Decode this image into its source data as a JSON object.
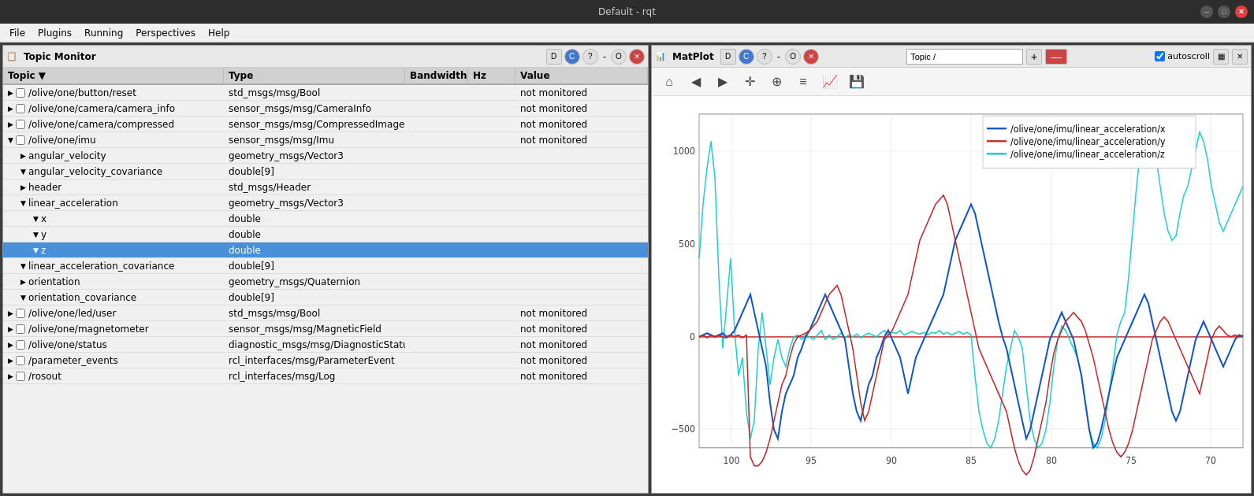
{
  "titlebar": {
    "title": "Default - rqt"
  },
  "menubar": {
    "items": [
      "File",
      "Plugins",
      "Running",
      "Perspectives",
      "Help"
    ]
  },
  "left_panel": {
    "title": "Topic Monitor",
    "table": {
      "headers": [
        "Topic",
        "Type",
        "Bandwidth",
        "Hz",
        "Value"
      ],
      "rows": [
        {
          "indent": 1,
          "expand": true,
          "checked": false,
          "topic": "/olive/one/button/reset",
          "type": "std_msgs/msg/Bool",
          "bandwidth": "",
          "hz": "",
          "value": "not monitored",
          "selected": false
        },
        {
          "indent": 1,
          "expand": true,
          "checked": false,
          "topic": "/olive/one/camera/camera_info",
          "type": "sensor_msgs/msg/CameraInfo",
          "bandwidth": "",
          "hz": "",
          "value": "not monitored",
          "selected": false
        },
        {
          "indent": 1,
          "expand": true,
          "checked": false,
          "topic": "/olive/one/camera/compressed",
          "type": "sensor_msgs/msg/CompressedImage",
          "bandwidth": "",
          "hz": "",
          "value": "not monitored",
          "selected": false
        },
        {
          "indent": 1,
          "expand": false,
          "checked": false,
          "topic": "/olive/one/imu",
          "type": "sensor_msgs/msg/Imu",
          "bandwidth": "",
          "hz": "",
          "value": "not monitored",
          "selected": false
        },
        {
          "indent": 2,
          "expand": true,
          "checked": false,
          "topic": "angular_velocity",
          "type": "geometry_msgs/Vector3",
          "bandwidth": "",
          "hz": "",
          "value": "",
          "selected": false
        },
        {
          "indent": 2,
          "expand": false,
          "checked": false,
          "topic": "angular_velocity_covariance",
          "type": "double[9]",
          "bandwidth": "",
          "hz": "",
          "value": "",
          "selected": false
        },
        {
          "indent": 2,
          "expand": true,
          "checked": false,
          "topic": "header",
          "type": "std_msgs/Header",
          "bandwidth": "",
          "hz": "",
          "value": "",
          "selected": false
        },
        {
          "indent": 2,
          "expand": false,
          "checked": false,
          "topic": "linear_acceleration",
          "type": "geometry_msgs/Vector3",
          "bandwidth": "",
          "hz": "",
          "value": "",
          "selected": false
        },
        {
          "indent": 3,
          "expand": false,
          "checked": false,
          "topic": "x",
          "type": "double",
          "bandwidth": "",
          "hz": "",
          "value": "",
          "selected": false
        },
        {
          "indent": 3,
          "expand": false,
          "checked": false,
          "topic": "y",
          "type": "double",
          "bandwidth": "",
          "hz": "",
          "value": "",
          "selected": false
        },
        {
          "indent": 3,
          "expand": false,
          "checked": false,
          "topic": "z",
          "type": "double",
          "bandwidth": "",
          "hz": "",
          "value": "",
          "selected": true
        },
        {
          "indent": 2,
          "expand": false,
          "checked": false,
          "topic": "linear_acceleration_covariance",
          "type": "double[9]",
          "bandwidth": "",
          "hz": "",
          "value": "",
          "selected": false
        },
        {
          "indent": 2,
          "expand": true,
          "checked": false,
          "topic": "orientation",
          "type": "geometry_msgs/Quaternion",
          "bandwidth": "",
          "hz": "",
          "value": "",
          "selected": false
        },
        {
          "indent": 2,
          "expand": false,
          "checked": false,
          "topic": "orientation_covariance",
          "type": "double[9]",
          "bandwidth": "",
          "hz": "",
          "value": "",
          "selected": false
        },
        {
          "indent": 1,
          "expand": true,
          "checked": false,
          "topic": "/olive/one/led/user",
          "type": "std_msgs/msg/Bool",
          "bandwidth": "",
          "hz": "",
          "value": "not monitored",
          "selected": false
        },
        {
          "indent": 1,
          "expand": true,
          "checked": false,
          "topic": "/olive/one/magnetometer",
          "type": "sensor_msgs/msg/MagneticField",
          "bandwidth": "",
          "hz": "",
          "value": "not monitored",
          "selected": false
        },
        {
          "indent": 1,
          "expand": true,
          "checked": false,
          "topic": "/olive/one/status",
          "type": "diagnostic_msgs/msg/DiagnosticStatus",
          "bandwidth": "",
          "hz": "",
          "value": "not monitored",
          "selected": false
        },
        {
          "indent": 1,
          "expand": true,
          "checked": false,
          "topic": "/parameter_events",
          "type": "rcl_interfaces/msg/ParameterEvent",
          "bandwidth": "",
          "hz": "",
          "value": "not monitored",
          "selected": false
        },
        {
          "indent": 1,
          "expand": true,
          "checked": false,
          "topic": "/rosout",
          "type": "rcl_interfaces/msg/Log",
          "bandwidth": "",
          "hz": "",
          "value": "not monitored",
          "selected": false
        }
      ]
    }
  },
  "right_panel": {
    "title": "MatPlot",
    "topic_input": "Topic /",
    "topic_placeholder": "Topic /",
    "autoscroll": true,
    "autoscroll_label": "autoscroll",
    "legend": [
      {
        "label": "/olive/one/imu/linear_acceleration/x",
        "color": "#0000cc"
      },
      {
        "label": "/olive/one/imu/linear_acceleration/y",
        "color": "#cc0000"
      },
      {
        "label": "/olive/one/imu/linear_acceleration/z",
        "color": "#00cccc"
      }
    ],
    "xaxis": {
      "labels": [
        "100",
        "95",
        "90",
        "85",
        "80",
        "75",
        "70"
      ]
    },
    "yaxis": {
      "labels": [
        "1000",
        "500",
        "0",
        "-500"
      ]
    },
    "plot_tools": [
      "🏠",
      "◀",
      "▶",
      "✛",
      "🔍",
      "≡",
      "📈",
      "💾"
    ]
  },
  "window_controls": {
    "minimize": "─",
    "maximize": "□",
    "close": "✕"
  },
  "left_panel_controls": {
    "d_label": "D",
    "c_label": "C",
    "q_label": "?",
    "minus": "–",
    "o_label": "O",
    "close": "✕"
  },
  "right_panel_controls": {
    "d_label": "D",
    "c_label": "C",
    "q_label": "?",
    "minus": "–",
    "o_label": "O",
    "close": "✕",
    "grid1": "▦",
    "grid2": "▩"
  }
}
